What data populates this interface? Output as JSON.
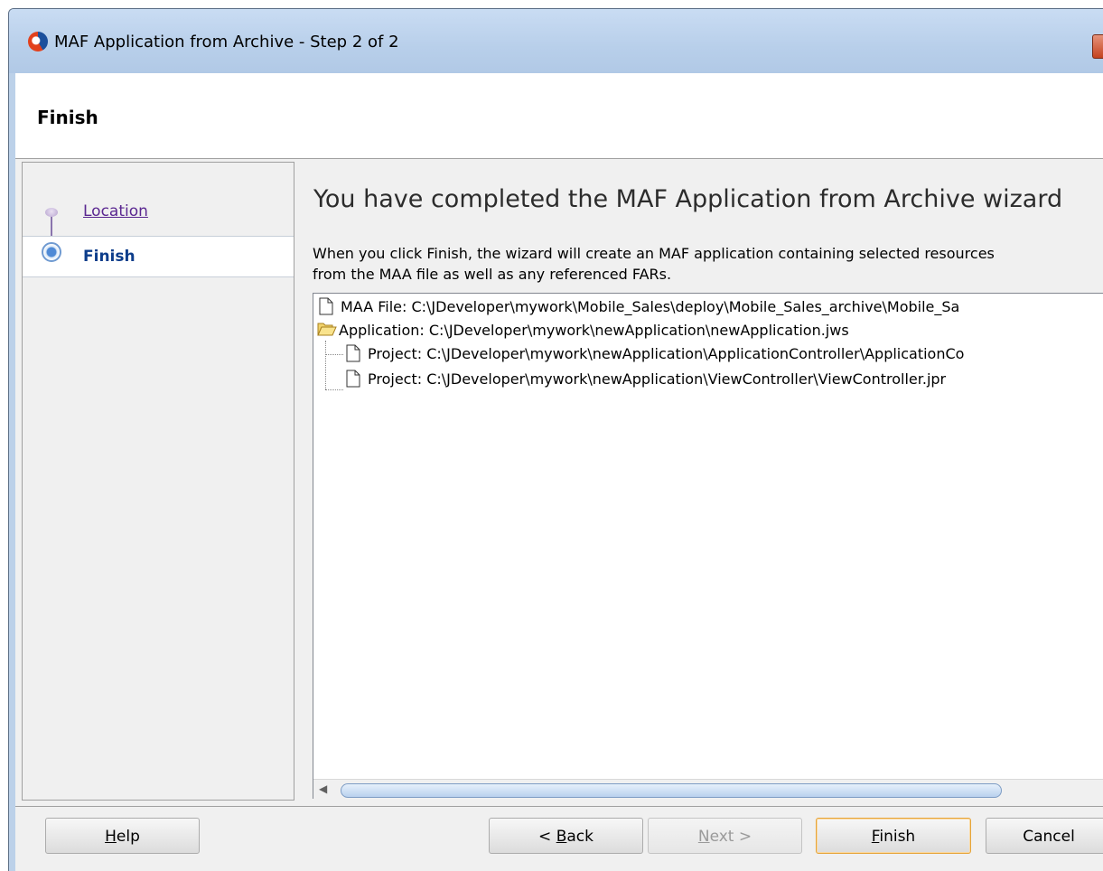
{
  "window": {
    "title": "MAF Application from Archive - Step 2 of 2"
  },
  "header": {
    "title": "Finish"
  },
  "nav": {
    "steps": [
      {
        "label": "Location"
      },
      {
        "label": "Finish"
      }
    ]
  },
  "content": {
    "heading": "You have completed the MAF Application from Archive wizard",
    "description": "When you click Finish, the wizard will create an MAF application containing selected resources\nfrom the MAA file as well as any referenced FARs.",
    "tree": [
      {
        "label": "MAA File:  C:\\JDeveloper\\mywork\\Mobile_Sales\\deploy\\Mobile_Sales_archive\\Mobile_Sa"
      },
      {
        "label": "Application: C:\\JDeveloper\\mywork\\newApplication\\newApplication.jws"
      },
      {
        "label": "Project: C:\\JDeveloper\\mywork\\newApplication\\ApplicationController\\ApplicationCo"
      },
      {
        "label": "Project: C:\\JDeveloper\\mywork\\newApplication\\ViewController\\ViewController.jpr"
      }
    ]
  },
  "buttons": {
    "help": {
      "pre": "",
      "mnemonic": "H",
      "post": "elp"
    },
    "back": {
      "pre": "< ",
      "mnemonic": "B",
      "post": "ack"
    },
    "next": {
      "pre": "",
      "mnemonic": "N",
      "post": "ext >"
    },
    "finish": {
      "pre": "",
      "mnemonic": "F",
      "post": "inish"
    },
    "cancel": {
      "pre": "",
      "mnemonic": "",
      "post": "Cancel"
    }
  },
  "colors": {
    "title_bar": "#b8cfea",
    "link_visited": "#5a2790",
    "active_step": "#0d3d8b",
    "default_button_border": "#e5a43a"
  }
}
